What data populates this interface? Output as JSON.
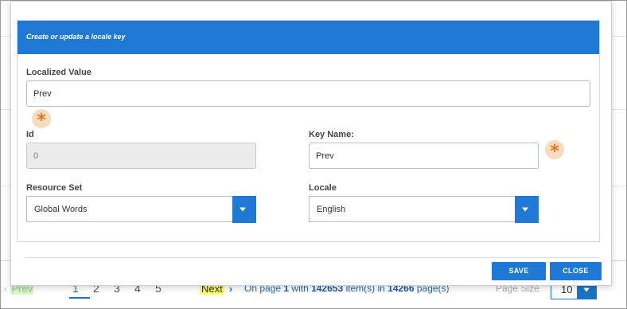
{
  "modal": {
    "title": "Create or update a locale key",
    "localized_value": {
      "label": "Localized Value",
      "value": "Prev"
    },
    "id_field": {
      "label": "Id",
      "value": "0"
    },
    "key_name": {
      "label": "Key Name:",
      "value": "Prev"
    },
    "resource_set": {
      "label": "Resource Set",
      "selected": "Global Words"
    },
    "locale": {
      "label": "Locale",
      "selected": "English"
    },
    "required_marker": "*",
    "save_label": "SAVE",
    "close_label": "CLOSE"
  },
  "pager": {
    "prev_label": "Prev",
    "pages": [
      "1",
      "2",
      "3",
      "4",
      "5"
    ],
    "active_page": "1",
    "next_label": "Next",
    "info": {
      "prefix": "On page ",
      "page": "1",
      "mid1": " with ",
      "items": "142653",
      "mid2": " item(s) in ",
      "pages": "14266",
      "suffix": " page(s)"
    },
    "page_size_label": "Page Size",
    "page_size_value": "10"
  },
  "colors": {
    "accent": "#1e78d4",
    "required_marker": "#e67722",
    "required_bg": "#f6dcc1",
    "prev_highlight": "#d9f7c9",
    "next_highlight": "#ffff66"
  }
}
